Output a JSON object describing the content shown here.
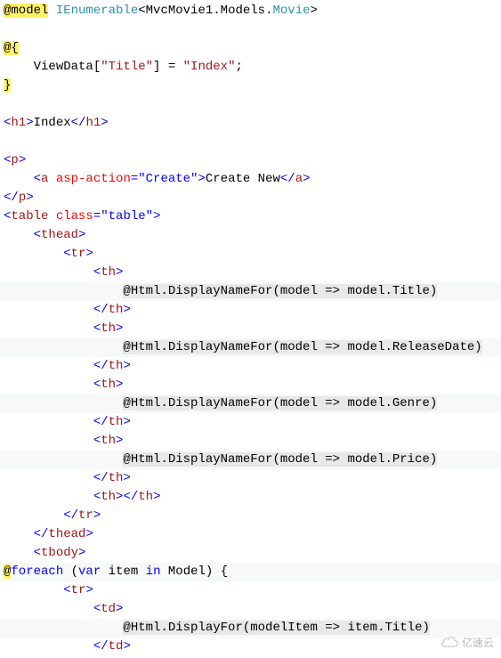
{
  "lines": [
    {
      "indent": 0,
      "cls": "",
      "parts": [
        {
          "t": "@model",
          "c": "bg-hl"
        },
        {
          "t": " ",
          "c": ""
        },
        {
          "t": "IEnumerable",
          "c": "kw-teal"
        },
        {
          "t": "<MvcMovie1.Models.",
          "c": ""
        },
        {
          "t": "Movie",
          "c": "kw-teal"
        },
        {
          "t": ">",
          "c": ""
        }
      ]
    },
    {
      "indent": 0,
      "cls": "",
      "parts": [
        {
          "t": " ",
          "c": ""
        }
      ]
    },
    {
      "indent": 0,
      "cls": "",
      "parts": [
        {
          "t": "@{",
          "c": "bg-hl"
        }
      ]
    },
    {
      "indent": 1,
      "cls": "",
      "parts": [
        {
          "t": "ViewData[",
          "c": ""
        },
        {
          "t": "\"Title\"",
          "c": "str-red"
        },
        {
          "t": "] = ",
          "c": ""
        },
        {
          "t": "\"Index\"",
          "c": "str-red"
        },
        {
          "t": ";",
          "c": ""
        }
      ]
    },
    {
      "indent": 0,
      "cls": "",
      "parts": [
        {
          "t": "}",
          "c": "bg-hl"
        }
      ]
    },
    {
      "indent": 0,
      "cls": "",
      "parts": [
        {
          "t": " ",
          "c": ""
        }
      ]
    },
    {
      "indent": 0,
      "cls": "",
      "parts": [
        {
          "t": "<",
          "c": "tag-blue"
        },
        {
          "t": "h1",
          "c": "tag-red"
        },
        {
          "t": ">",
          "c": "tag-blue"
        },
        {
          "t": "Index",
          "c": ""
        },
        {
          "t": "</",
          "c": "tag-blue"
        },
        {
          "t": "h1",
          "c": "tag-red"
        },
        {
          "t": ">",
          "c": "tag-blue"
        }
      ]
    },
    {
      "indent": 0,
      "cls": "",
      "parts": [
        {
          "t": " ",
          "c": ""
        }
      ]
    },
    {
      "indent": 0,
      "cls": "",
      "parts": [
        {
          "t": "<",
          "c": "tag-blue"
        },
        {
          "t": "p",
          "c": "tag-red"
        },
        {
          "t": ">",
          "c": "tag-blue"
        }
      ]
    },
    {
      "indent": 1,
      "cls": "",
      "parts": [
        {
          "t": "<",
          "c": "tag-blue"
        },
        {
          "t": "a",
          "c": "tag-red"
        },
        {
          "t": " ",
          "c": ""
        },
        {
          "t": "asp-action",
          "c": "attr"
        },
        {
          "t": "=",
          "c": "tag-blue"
        },
        {
          "t": "\"Create\"",
          "c": "attr-val"
        },
        {
          "t": ">",
          "c": "tag-blue"
        },
        {
          "t": "Create New",
          "c": ""
        },
        {
          "t": "</",
          "c": "tag-blue"
        },
        {
          "t": "a",
          "c": "tag-red"
        },
        {
          "t": ">",
          "c": "tag-blue"
        }
      ]
    },
    {
      "indent": 0,
      "cls": "",
      "parts": [
        {
          "t": "</",
          "c": "tag-blue"
        },
        {
          "t": "p",
          "c": "tag-red"
        },
        {
          "t": ">",
          "c": "tag-blue"
        }
      ]
    },
    {
      "indent": 0,
      "cls": "",
      "parts": [
        {
          "t": "<",
          "c": "tag-blue"
        },
        {
          "t": "table",
          "c": "tag-red"
        },
        {
          "t": " ",
          "c": ""
        },
        {
          "t": "class",
          "c": "attr"
        },
        {
          "t": "=",
          "c": "tag-blue"
        },
        {
          "t": "\"table\"",
          "c": "attr-val"
        },
        {
          "t": ">",
          "c": "tag-blue"
        }
      ]
    },
    {
      "indent": 1,
      "cls": "",
      "parts": [
        {
          "t": "<",
          "c": "tag-blue"
        },
        {
          "t": "thead",
          "c": "tag-red"
        },
        {
          "t": ">",
          "c": "tag-blue"
        }
      ]
    },
    {
      "indent": 2,
      "cls": "",
      "parts": [
        {
          "t": "<",
          "c": "tag-blue"
        },
        {
          "t": "tr",
          "c": "tag-red"
        },
        {
          "t": ">",
          "c": "tag-blue"
        }
      ]
    },
    {
      "indent": 3,
      "cls": "",
      "parts": [
        {
          "t": "<",
          "c": "tag-blue"
        },
        {
          "t": "th",
          "c": "tag-red"
        },
        {
          "t": ">",
          "c": "tag-blue"
        }
      ]
    },
    {
      "indent": 4,
      "cls": "hl-line",
      "parts": [
        {
          "t": "@",
          "c": "bg-hl grey-bg"
        },
        {
          "t": "Html.DisplayNameFor(model => model.Title)",
          "c": "grey-bg"
        }
      ]
    },
    {
      "indent": 3,
      "cls": "",
      "parts": [
        {
          "t": "</",
          "c": "tag-blue"
        },
        {
          "t": "th",
          "c": "tag-red"
        },
        {
          "t": ">",
          "c": "tag-blue"
        }
      ]
    },
    {
      "indent": 3,
      "cls": "",
      "parts": [
        {
          "t": "<",
          "c": "tag-blue"
        },
        {
          "t": "th",
          "c": "tag-red"
        },
        {
          "t": ">",
          "c": "tag-blue"
        }
      ]
    },
    {
      "indent": 4,
      "cls": "hl-line",
      "parts": [
        {
          "t": "@",
          "c": "bg-hl grey-bg"
        },
        {
          "t": "Html.DisplayNameFor(model => model.ReleaseDate)",
          "c": "grey-bg"
        }
      ]
    },
    {
      "indent": 3,
      "cls": "",
      "parts": [
        {
          "t": "</",
          "c": "tag-blue"
        },
        {
          "t": "th",
          "c": "tag-red"
        },
        {
          "t": ">",
          "c": "tag-blue"
        }
      ]
    },
    {
      "indent": 3,
      "cls": "",
      "parts": [
        {
          "t": "<",
          "c": "tag-blue"
        },
        {
          "t": "th",
          "c": "tag-red"
        },
        {
          "t": ">",
          "c": "tag-blue"
        }
      ]
    },
    {
      "indent": 4,
      "cls": "hl-line",
      "parts": [
        {
          "t": "@",
          "c": "bg-hl grey-bg"
        },
        {
          "t": "Html.DisplayNameFor(model => model.Genre)",
          "c": "grey-bg"
        }
      ]
    },
    {
      "indent": 3,
      "cls": "",
      "parts": [
        {
          "t": "</",
          "c": "tag-blue"
        },
        {
          "t": "th",
          "c": "tag-red"
        },
        {
          "t": ">",
          "c": "tag-blue"
        }
      ]
    },
    {
      "indent": 3,
      "cls": "",
      "parts": [
        {
          "t": "<",
          "c": "tag-blue"
        },
        {
          "t": "th",
          "c": "tag-red"
        },
        {
          "t": ">",
          "c": "tag-blue"
        }
      ]
    },
    {
      "indent": 4,
      "cls": "hl-line",
      "parts": [
        {
          "t": "@",
          "c": "bg-hl grey-bg"
        },
        {
          "t": "Html.DisplayNameFor(model => model.Price)",
          "c": "grey-bg"
        }
      ]
    },
    {
      "indent": 3,
      "cls": "",
      "parts": [
        {
          "t": "</",
          "c": "tag-blue"
        },
        {
          "t": "th",
          "c": "tag-red"
        },
        {
          "t": ">",
          "c": "tag-blue"
        }
      ]
    },
    {
      "indent": 3,
      "cls": "",
      "parts": [
        {
          "t": "<",
          "c": "tag-blue"
        },
        {
          "t": "th",
          "c": "tag-red"
        },
        {
          "t": "></",
          "c": "tag-blue"
        },
        {
          "t": "th",
          "c": "tag-red"
        },
        {
          "t": ">",
          "c": "tag-blue"
        }
      ]
    },
    {
      "indent": 2,
      "cls": "",
      "parts": [
        {
          "t": "</",
          "c": "tag-blue"
        },
        {
          "t": "tr",
          "c": "tag-red"
        },
        {
          "t": ">",
          "c": "tag-blue"
        }
      ]
    },
    {
      "indent": 1,
      "cls": "",
      "parts": [
        {
          "t": "</",
          "c": "tag-blue"
        },
        {
          "t": "thead",
          "c": "tag-red"
        },
        {
          "t": ">",
          "c": "tag-blue"
        }
      ]
    },
    {
      "indent": 1,
      "cls": "",
      "parts": [
        {
          "t": "<",
          "c": "tag-blue"
        },
        {
          "t": "tbody",
          "c": "tag-red"
        },
        {
          "t": ">",
          "c": "tag-blue"
        }
      ]
    },
    {
      "indent": 0,
      "cls": "hl-line",
      "parts": [
        {
          "t": "@",
          "c": "bg-hl"
        },
        {
          "t": "foreach",
          "c": "kw-blue"
        },
        {
          "t": " (",
          "c": ""
        },
        {
          "t": "var",
          "c": "kw-blue"
        },
        {
          "t": " item ",
          "c": ""
        },
        {
          "t": "in",
          "c": "kw-blue"
        },
        {
          "t": " Model) {",
          "c": ""
        }
      ]
    },
    {
      "indent": 2,
      "cls": "",
      "parts": [
        {
          "t": "<",
          "c": "tag-blue"
        },
        {
          "t": "tr",
          "c": "tag-red"
        },
        {
          "t": ">",
          "c": "tag-blue"
        }
      ]
    },
    {
      "indent": 3,
      "cls": "",
      "parts": [
        {
          "t": "<",
          "c": "tag-blue"
        },
        {
          "t": "td",
          "c": "tag-red"
        },
        {
          "t": ">",
          "c": "tag-blue"
        }
      ]
    },
    {
      "indent": 4,
      "cls": "hl-line",
      "parts": [
        {
          "t": "@",
          "c": "bg-hl grey-bg"
        },
        {
          "t": "Html.DisplayFor(modelItem => item.Title)",
          "c": "grey-bg"
        }
      ]
    },
    {
      "indent": 3,
      "cls": "",
      "parts": [
        {
          "t": "</",
          "c": "tag-blue"
        },
        {
          "t": "td",
          "c": "tag-red"
        },
        {
          "t": ">",
          "c": "tag-blue"
        }
      ]
    }
  ],
  "watermark": "亿速云"
}
